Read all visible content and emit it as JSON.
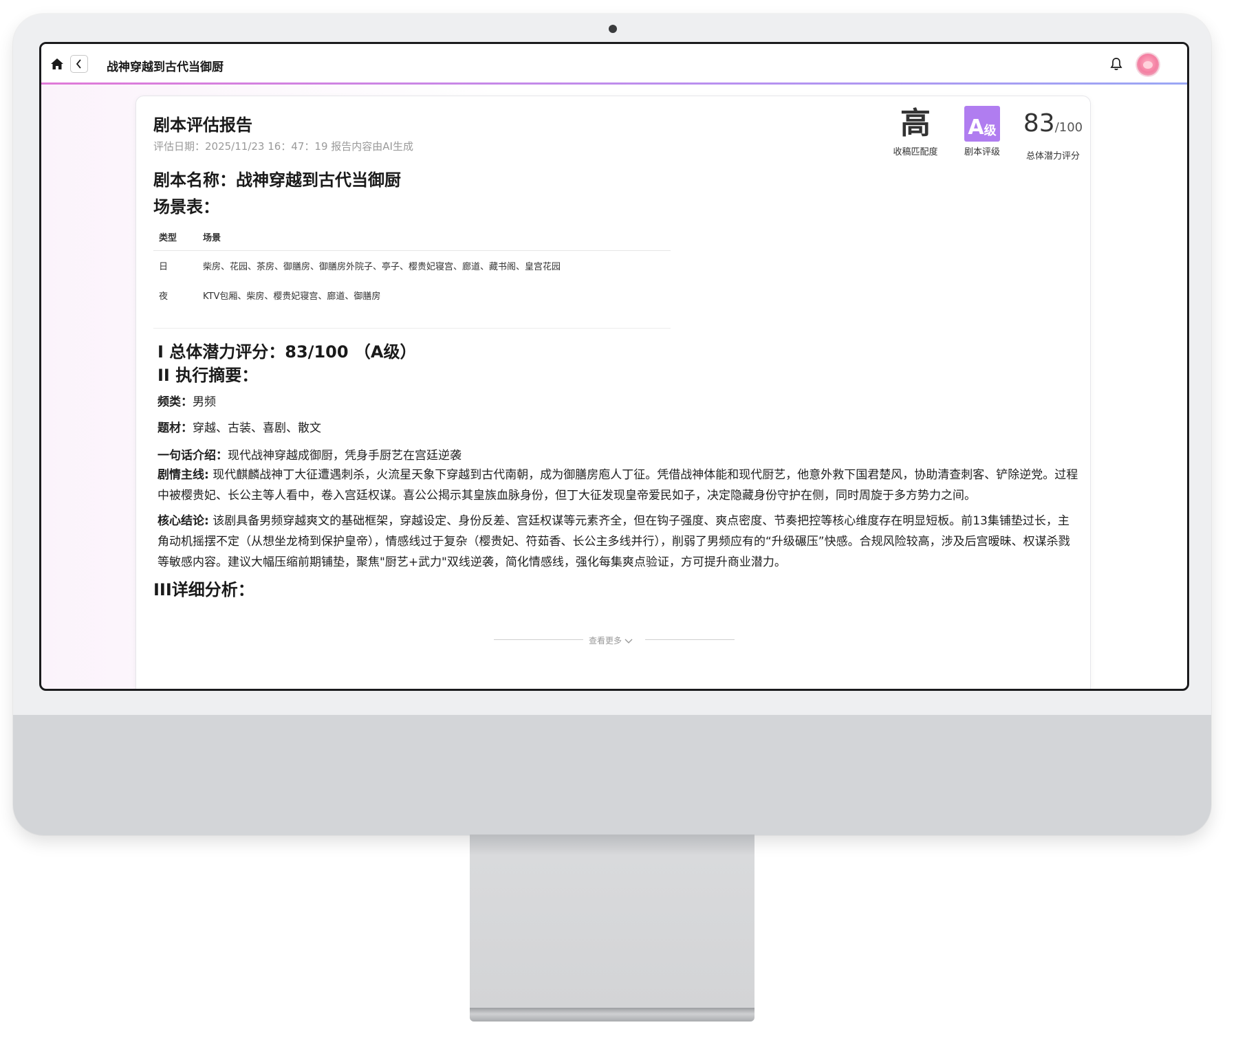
{
  "header": {
    "title": "战神穿越到古代当御厨"
  },
  "report": {
    "title": "剧本评估报告",
    "meta": "评估日期：2025/11/23 16：47：19 报告内容由AI生成",
    "stats": {
      "match_value": "高",
      "match_label": "收稿匹配度",
      "grade_letter": "A",
      "grade_suffix": "级",
      "grade_label": "剧本评级",
      "score_value": "83",
      "score_denom": "/100",
      "score_label": "总体潜力评分"
    },
    "script_name": "剧本名称：战神穿越到古代当御厨",
    "scene_heading": "场景表：",
    "scene_table": {
      "headers": [
        "类型",
        "场景"
      ],
      "rows": [
        [
          "日",
          "柴房、花园、茶房、御膳房、御膳房外院子、亭子、樱贵妃寝宫、廊道、藏书阁、皇宫花园"
        ],
        [
          "夜",
          "KTV包厢、柴房、樱贵妃寝宫、廊道、御膳房"
        ]
      ]
    },
    "section1": "I 总体潜力评分：83/100 （A级）",
    "section2": "II 执行摘要：",
    "genre_label": "频类：",
    "genre_value": "男频",
    "theme_label": "题材：",
    "theme_value": "穿越、古装、喜剧、散文",
    "logline_label": "一句话介绍：",
    "logline_value": "现代战神穿越成御厨，凭身手厨艺在宫廷逆袭",
    "plot_label": "剧情主线:",
    "plot_value": " 现代麒麟战神丁大征遭遇刺杀，火流星天象下穿越到古代南朝，成为御膳房庖人丁征。凭借战神体能和现代厨艺，他意外救下国君楚风，协助清查刺客、铲除逆党。过程中被樱贵妃、长公主等人看中，卷入宫廷权谋。喜公公揭示其皇族血脉身份，但丁大征发现皇帝爱民如子，决定隐藏身份守护在侧，同时周旋于多方势力之间。",
    "conclusion_label": "核心结论:",
    "conclusion_value": " 该剧具备男频穿越爽文的基础框架，穿越设定、身份反差、宫廷权谋等元素齐全，但在钩子强度、爽点密度、节奏把控等核心维度存在明显短板。前13集铺垫过长，主角动机摇摆不定（从想坐龙椅到保护皇帝），情感线过于复杂（樱贵妃、符茹香、长公主多线并行），削弱了男频应有的“升级碾压”快感。合规风险较高，涉及后宫暧昧、权谋杀戮等敏感内容。建议大幅压缩前期铺垫，聚焦\"厨艺+武力\"双线逆袭，简化情感线，强化每集爽点验证，方可提升商业潜力。",
    "section3": "III详细分析：",
    "see_more": "查看更多"
  },
  "colors": {
    "accent_gradient_start": "#e07ad8",
    "accent_gradient_end": "#9aa7f5",
    "grade_badge": "#b07df0"
  },
  "icons": {
    "home": "home-icon",
    "back": "chevron-left-icon",
    "bell": "bell-icon",
    "see_more": "chevron-down-icon"
  }
}
